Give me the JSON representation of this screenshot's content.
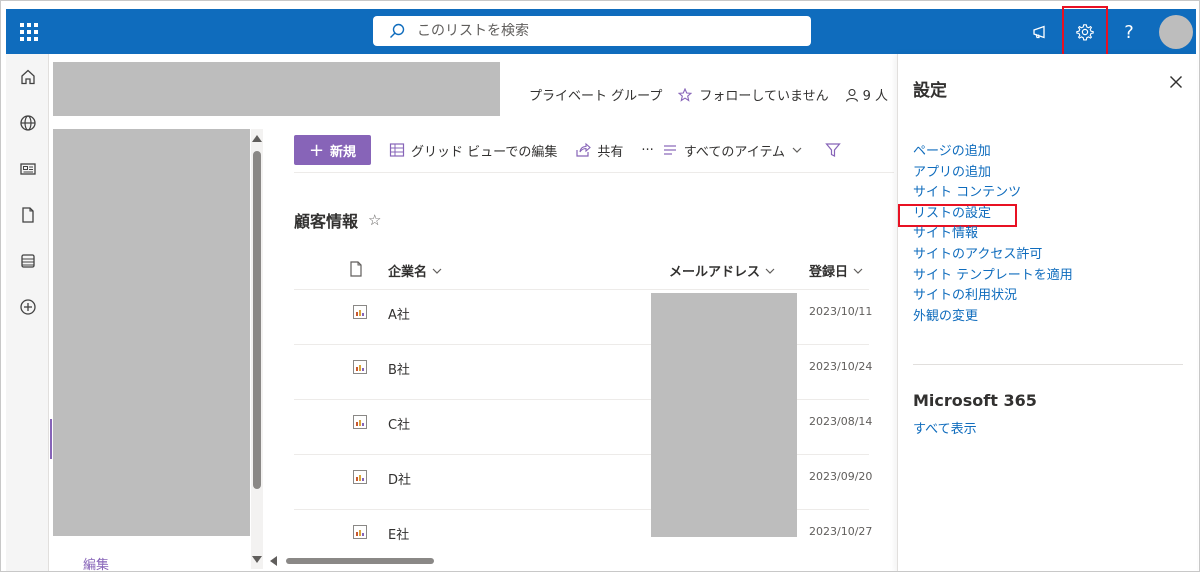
{
  "suitebar": {
    "search_placeholder": "このリストを検索",
    "help_label": "?"
  },
  "site_header": {
    "group_type": "プライベート グループ",
    "follow_label": "フォローしていません",
    "members_label": "9 人"
  },
  "site_nav": {
    "edit_label": "編集"
  },
  "commandbar": {
    "new_label": "新規",
    "grid_edit_label": "グリッド ビューでの編集",
    "share_label": "共有",
    "more_label": "···",
    "view_label": "すべてのアイテム"
  },
  "list": {
    "title": "顧客情報",
    "columns": {
      "company": "企業名",
      "email": "メールアドレス",
      "registered": "登録日"
    },
    "rows": [
      {
        "company": "A社",
        "date": "2023/10/11"
      },
      {
        "company": "B社",
        "date": "2023/10/24"
      },
      {
        "company": "C社",
        "date": "2023/08/14"
      },
      {
        "company": "D社",
        "date": "2023/09/20"
      },
      {
        "company": "E社",
        "date": "2023/10/27"
      }
    ]
  },
  "settings_panel": {
    "title": "設定",
    "links": [
      "ページの追加",
      "アプリの追加",
      "サイト コンテンツ",
      "リストの設定",
      "サイト情報",
      "サイトのアクセス許可",
      "サイト テンプレートを適用",
      "サイトの利用状況",
      "外観の変更"
    ],
    "highlighted_link_index": 3,
    "ms365_title": "Microsoft 365",
    "ms365_link": "すべて表示"
  },
  "colors": {
    "suitebar": "#0f6cbd",
    "accent": "#8764b8",
    "link": "#0f6cbd",
    "highlight": "#e81123"
  }
}
